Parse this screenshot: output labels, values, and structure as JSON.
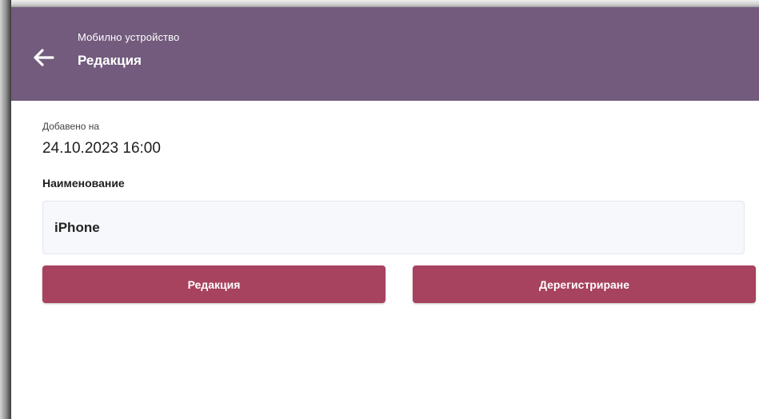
{
  "header": {
    "back_icon": "arrow-left-icon",
    "subtitle": "Мобилно устройство",
    "title": "Редакция",
    "background_color": "#725b7d"
  },
  "device": {
    "added_label": "Добавено на",
    "added_value": "24.10.2023 16:00",
    "name_label": "Наименование",
    "name_value": "iPhone"
  },
  "actions": {
    "edit_label": "Редакция",
    "deregister_label": "Дерегистриране",
    "button_color": "#a7425f"
  }
}
